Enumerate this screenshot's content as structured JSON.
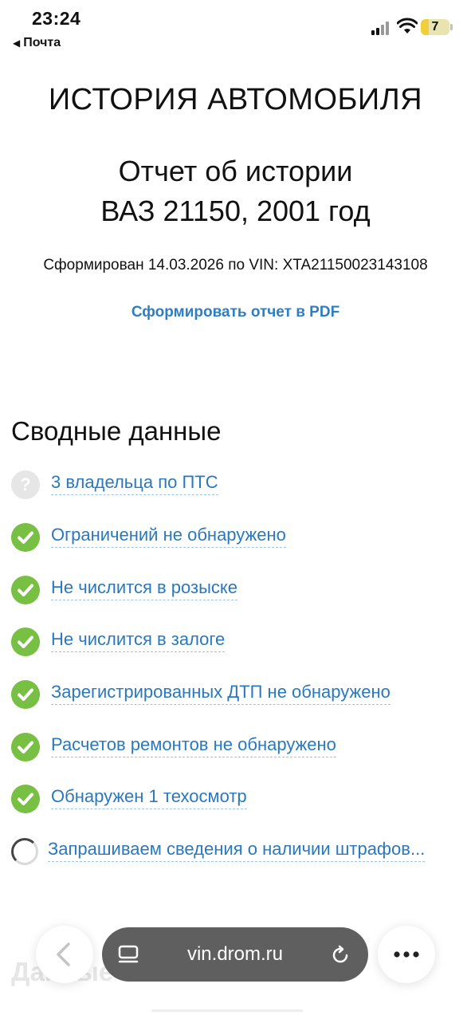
{
  "status_bar": {
    "time": "23:24",
    "back_app": "Почта",
    "battery_level": "7"
  },
  "page": {
    "site_title": "ИСТОРИЯ АВТОМОБИЛЯ",
    "report_title_line1": "Отчет об истории",
    "report_title_line2": "ВАЗ 21150, 2001 год",
    "generated_text": "Сформирован 14.03.2026 по VIN: XTA21150023143108",
    "pdf_link": "Сформировать отчет в PDF"
  },
  "summary": {
    "title": "Сводные данные",
    "items": [
      {
        "label": "3 владельца по ПТС",
        "status": "unknown",
        "icon": "question-icon"
      },
      {
        "label": "Ограничений не обнаружено",
        "status": "ok",
        "icon": "check-icon"
      },
      {
        "label": "Не числится в розыске",
        "status": "ok",
        "icon": "check-icon"
      },
      {
        "label": "Не числится в залоге",
        "status": "ok",
        "icon": "check-icon"
      },
      {
        "label": "Зарегистрированных ДТП не обнаружено",
        "status": "ok",
        "icon": "check-icon"
      },
      {
        "label": "Расчетов ремонтов не обнаружено",
        "status": "ok",
        "icon": "check-icon"
      },
      {
        "label": "Обнаружен 1 техосмотр",
        "status": "ok",
        "icon": "check-icon"
      },
      {
        "label": "Запрашиваем сведения о наличии штрафов...",
        "status": "loading",
        "icon": "spinner-icon"
      }
    ]
  },
  "next_section_partial": "Данные по ПТС",
  "browser": {
    "url": "vin.drom.ru"
  },
  "colors": {
    "link": "#2a78bd",
    "check": "#78c043",
    "url_bar": "#5f5f5f"
  }
}
